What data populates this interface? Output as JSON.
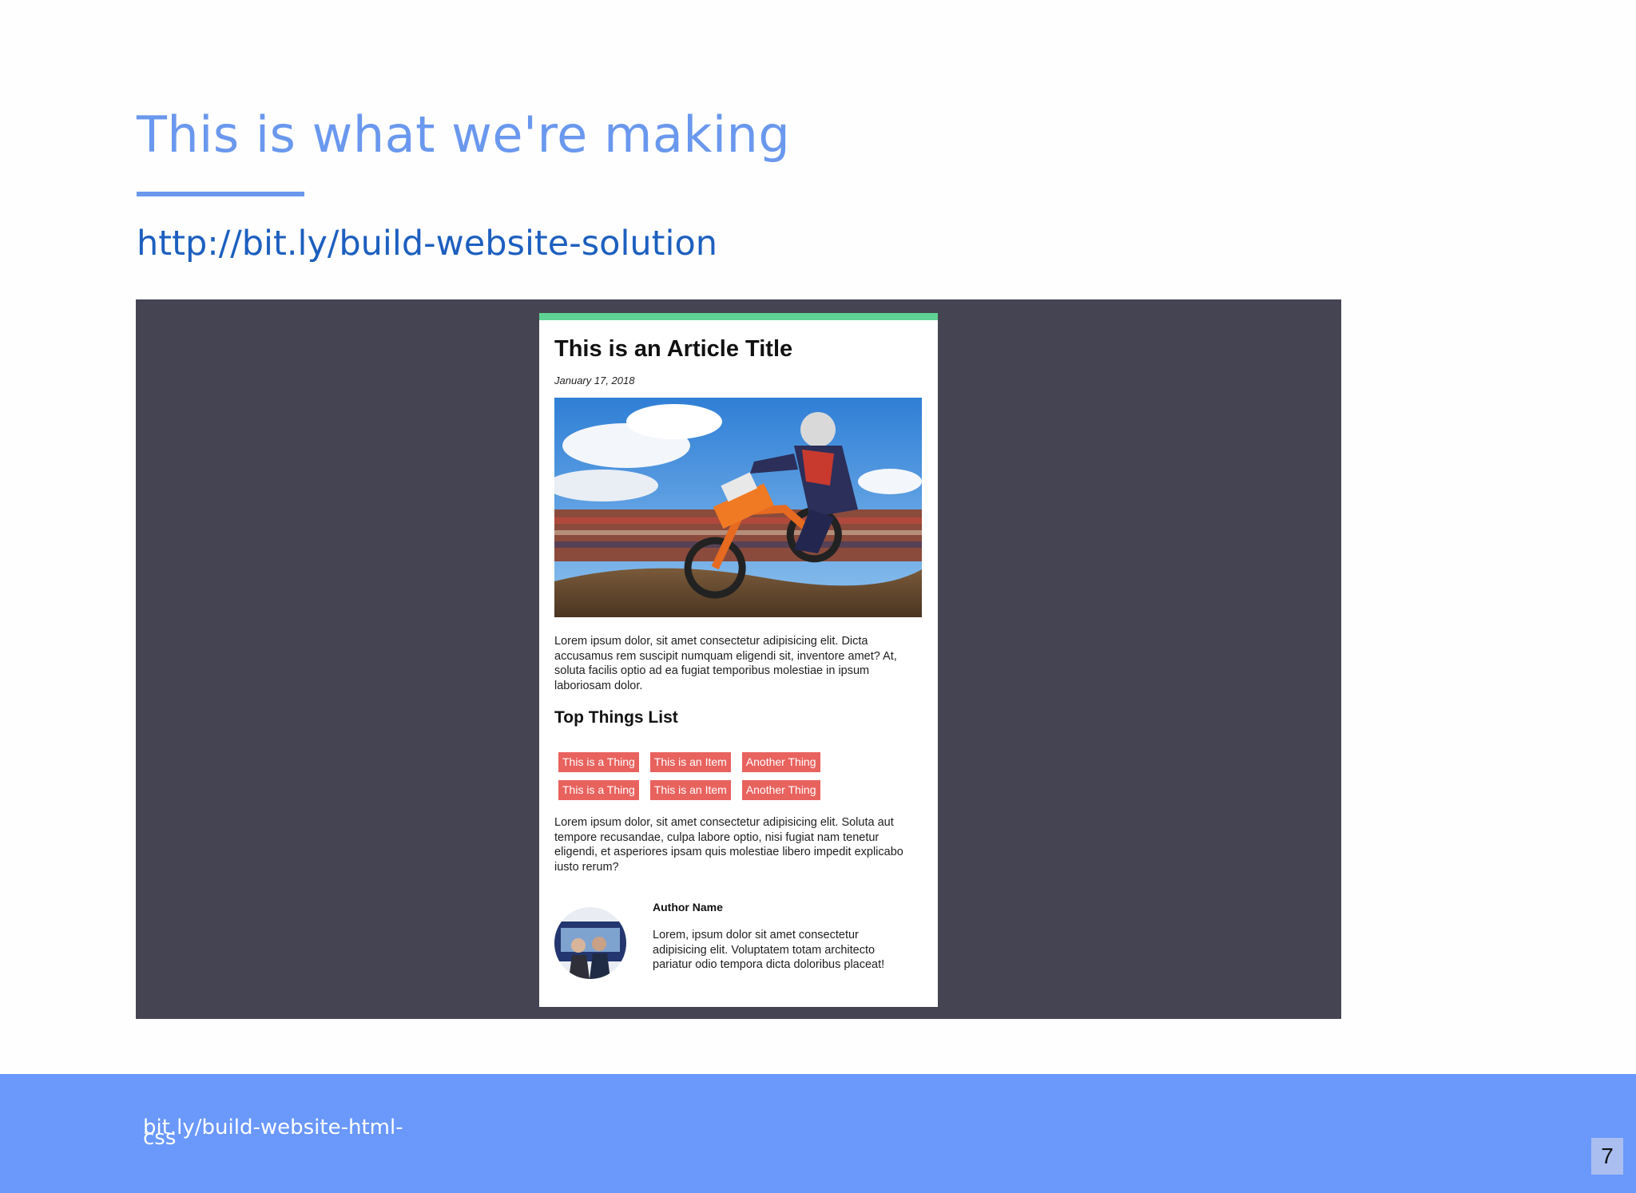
{
  "slide": {
    "title": "This is what we're making",
    "link": "http://bit.ly/build-website-solution"
  },
  "preview": {
    "article_title": "This is an Article Title",
    "date": "January 17, 2018",
    "intro_paragraph": "Lorem ipsum dolor, sit amet consectetur adipisicing elit. Dicta accusamus rem suscipit numquam eligendi sit, inventore amet? At, soluta facilis optio ad ea fugiat temporibus molestiae in ipsum laboriosam dolor.",
    "list_heading": "Top Things List",
    "list_items": [
      "This is a Thing",
      "This is an Item",
      "Another Thing",
      "This is a Thing",
      "This is an Item",
      "Another Thing"
    ],
    "second_paragraph": "Lorem ipsum dolor, sit amet consectetur adipisicing elit. Soluta aut tempore recusandae, culpa labore optio, nisi fugiat nam tenetur eligendi, et asperiores ipsam quis molestiae libero impedit explicabo iusto rerum?",
    "author_name": "Author Name",
    "author_bio": "Lorem, ipsum dolor sit amet consectetur adipisicing elit. Voluptatem totam architecto pariatur odio tempora dicta doloribus placeat!"
  },
  "footer": {
    "link": "bit.ly/build-website-html-css",
    "page_number": "7"
  },
  "colors": {
    "title_blue": "#6a98ee",
    "link_blue": "#1c5fbf",
    "stage_bg": "#454452",
    "card_top_border": "#5fd393",
    "tag_red": "#e8625e",
    "footer_blue": "#6a98fb"
  }
}
